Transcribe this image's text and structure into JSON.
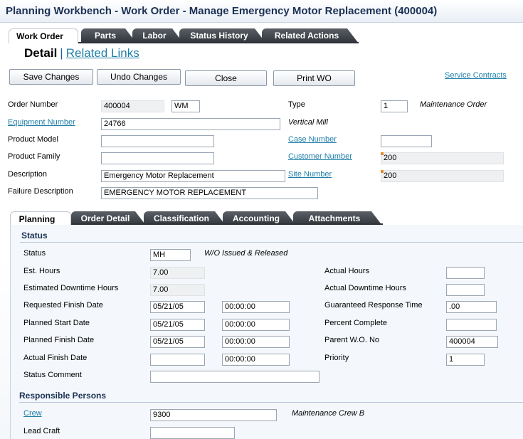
{
  "window": {
    "title": "Planning Workbench - Work Order - Manage Emergency Motor Replacement (400004)"
  },
  "top_tabs": [
    {
      "label": "Work Order",
      "active": true
    },
    {
      "label": "Parts"
    },
    {
      "label": "Labor"
    },
    {
      "label": "Status History"
    },
    {
      "label": "Related Actions"
    }
  ],
  "header": {
    "detail": "Detail",
    "separator": "|",
    "related_links": "Related Links"
  },
  "toolbar": {
    "save": "Save Changes",
    "undo": "Undo Changes",
    "close": "Close",
    "print": "Print WO",
    "service_contracts": "Service Contracts"
  },
  "form": {
    "order_number_label": "Order Number",
    "order_number": "400004",
    "order_type": "WM",
    "type_label": "Type",
    "type_value": "1",
    "type_desc": "Maintenance Order",
    "equipment_label": "Equipment Number",
    "equipment_value": "24766",
    "equipment_desc": "Vertical Mill",
    "product_model_label": "Product Model",
    "product_model_value": "",
    "case_number_label": "Case Number",
    "case_number_value": "",
    "product_family_label": "Product Family",
    "product_family_value": "",
    "customer_number_label": "Customer Number",
    "customer_number_value": "200",
    "description_label": "Description",
    "description_value": "Emergency Motor Replacement",
    "site_number_label": "Site Number",
    "site_number_value": "200",
    "failure_desc_label": "Failure Description",
    "failure_desc_value": "EMERGENCY MOTOR REPLACEMENT"
  },
  "sub_tabs": [
    {
      "label": "Planning",
      "active": true
    },
    {
      "label": "Order Detail"
    },
    {
      "label": "Classification"
    },
    {
      "label": "Accounting"
    },
    {
      "label": "Attachments"
    }
  ],
  "status_section": {
    "title": "Status",
    "status_label": "Status",
    "status_value": "MH",
    "status_desc": "W/O Issued & Released",
    "est_hours_label": "Est. Hours",
    "est_hours_value": "7.00",
    "actual_hours_label": "Actual Hours",
    "actual_hours_value": "",
    "est_downtime_label": "Estimated Downtime Hours",
    "est_downtime_value": "7.00",
    "actual_downtime_label": "Actual Downtime Hours",
    "actual_downtime_value": "",
    "req_finish_label": "Requested Finish Date",
    "req_finish_date": "05/21/05",
    "req_finish_time": "00:00:00",
    "guaranteed_label": "Guaranteed Response Time",
    "guaranteed_value": ".00",
    "planned_start_label": "Planned Start Date",
    "planned_start_date": "05/21/05",
    "planned_start_time": "00:00:00",
    "percent_label": "Percent Complete",
    "percent_value": "",
    "planned_finish_label": "Planned Finish Date",
    "planned_finish_date": "05/21/05",
    "planned_finish_time": "00:00:00",
    "parent_label": "Parent W.O. No",
    "parent_value": "400004",
    "actual_finish_label": "Actual Finish Date",
    "actual_finish_date": "",
    "actual_finish_time": "00:00:00",
    "priority_label": "Priority",
    "priority_value": "1",
    "status_comment_label": "Status Comment",
    "status_comment_value": ""
  },
  "responsible_section": {
    "title": "Responsible Persons",
    "crew_label": "Crew",
    "crew_value": "9300",
    "crew_desc": "Maintenance Crew B",
    "lead_craft_label": "Lead Craft",
    "lead_craft_value": ""
  }
}
